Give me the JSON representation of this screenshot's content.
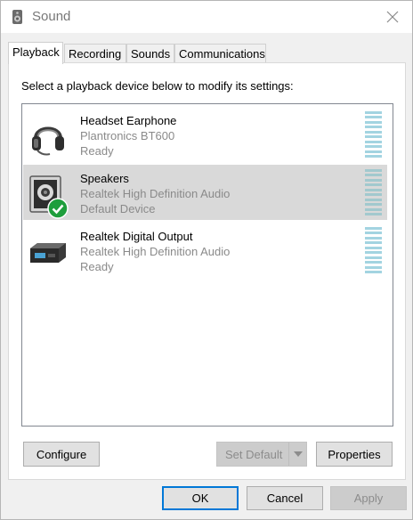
{
  "window": {
    "title": "Sound",
    "title_icon": "speaker-icon",
    "close_icon": "close-icon"
  },
  "tabs": [
    {
      "label": "Playback",
      "active": true
    },
    {
      "label": "Recording",
      "active": false
    },
    {
      "label": "Sounds",
      "active": false
    },
    {
      "label": "Communications",
      "active": false
    }
  ],
  "panel": {
    "instruction": "Select a playback device below to modify its settings:"
  },
  "devices": [
    {
      "name": "Headset Earphone",
      "description": "Plantronics BT600",
      "status": "Ready",
      "icon": "headset-icon",
      "selected": false,
      "default": false
    },
    {
      "name": "Speakers",
      "description": "Realtek High Definition Audio",
      "status": "Default Device",
      "icon": "speaker-device-icon",
      "selected": true,
      "default": true
    },
    {
      "name": "Realtek Digital Output",
      "description": "Realtek High Definition Audio",
      "status": "Ready",
      "icon": "digital-output-icon",
      "selected": false,
      "default": false
    }
  ],
  "buttons": {
    "configure": "Configure",
    "set_default": "Set Default",
    "properties": "Properties",
    "ok": "OK",
    "cancel": "Cancel",
    "apply": "Apply"
  },
  "colors": {
    "selection": "#d9d9d9",
    "level_meter": "#a3d4e1",
    "default_check": "#1e9e3c",
    "focus_border": "#0078d7"
  }
}
